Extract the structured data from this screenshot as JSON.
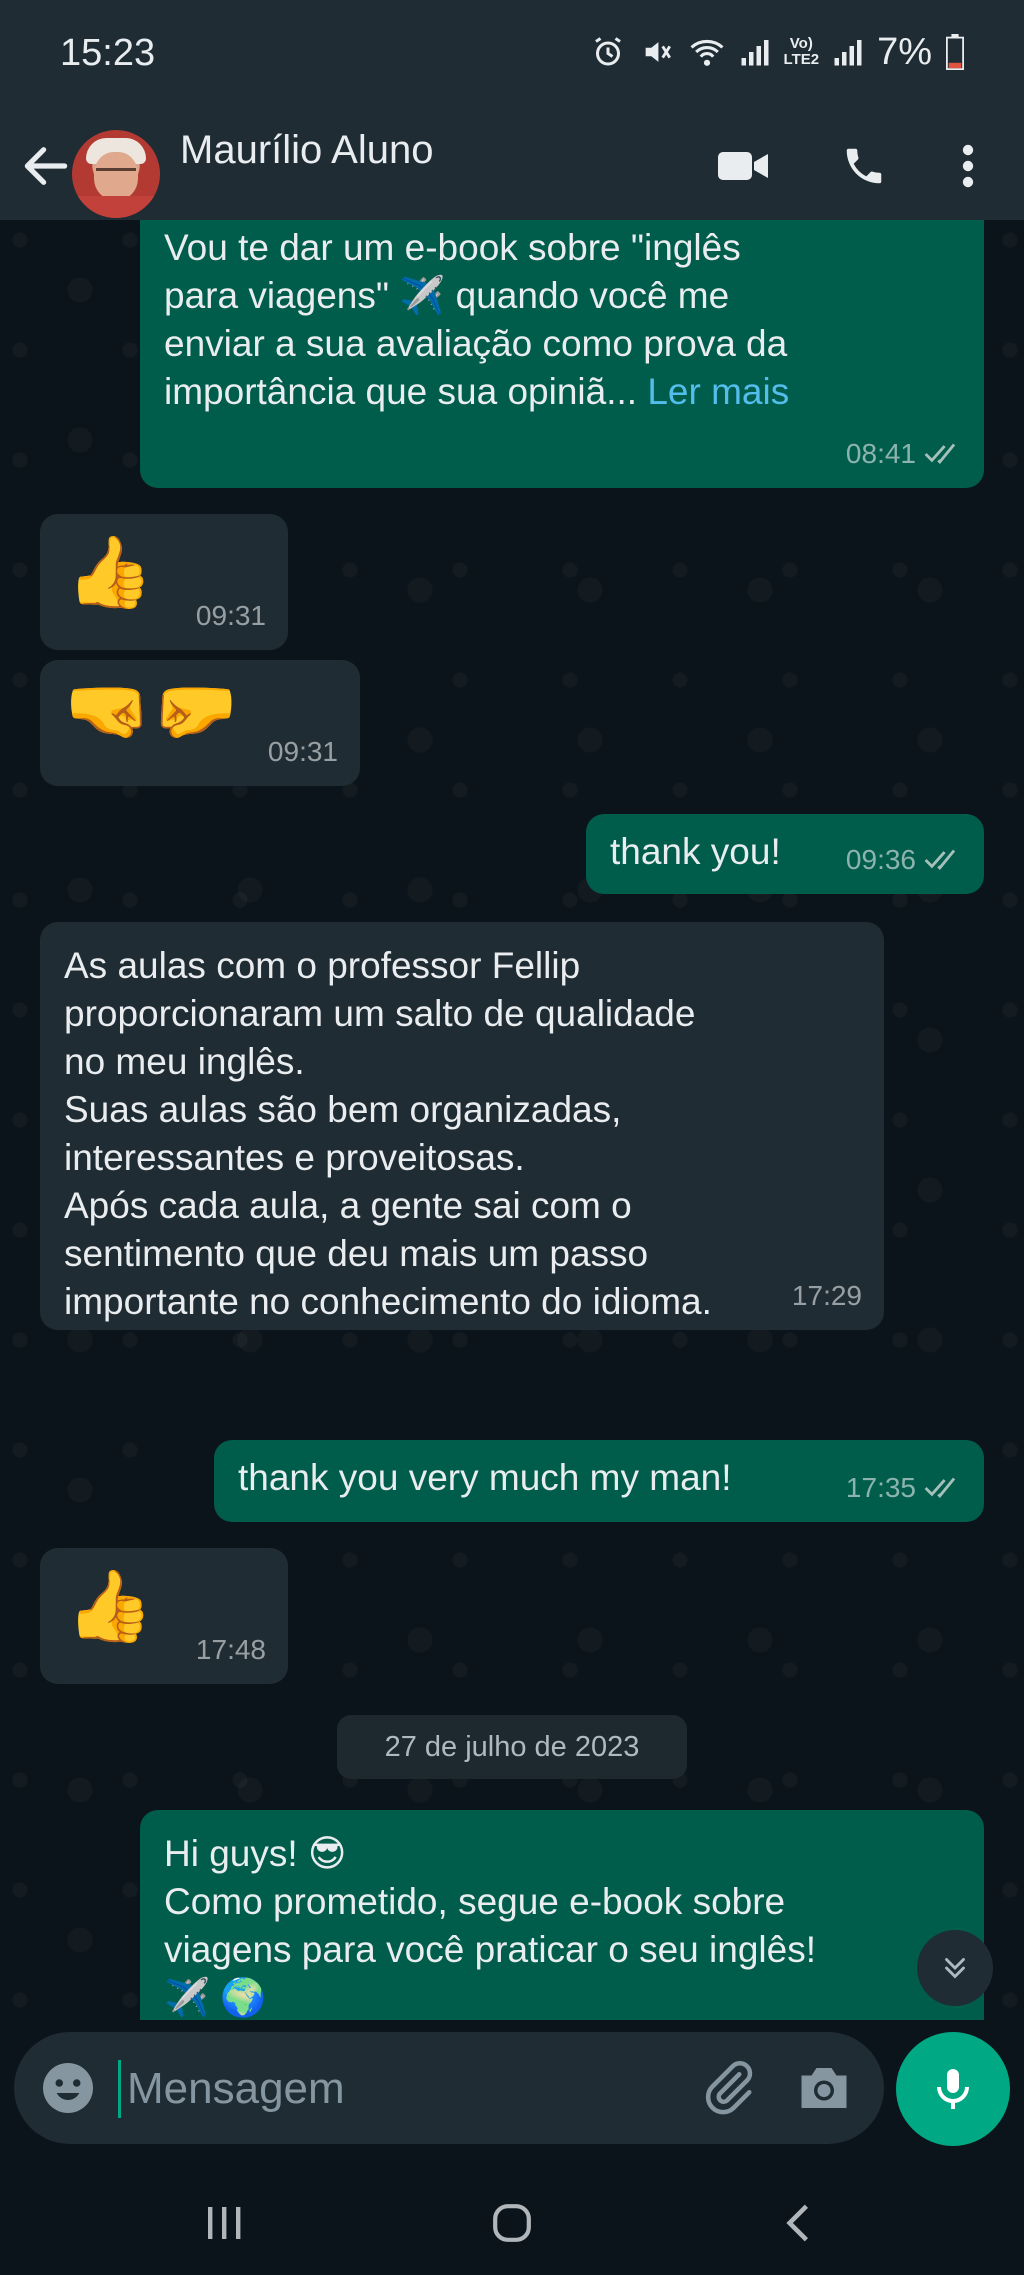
{
  "status_bar": {
    "time": "15:23",
    "lte_label_top": "Vo)",
    "lte_label_bottom": "LTE2",
    "battery": "7%"
  },
  "header": {
    "contact_name": "Maurílio Aluno",
    "icons": [
      "back-arrow-icon",
      "video-call-icon",
      "phone-icon",
      "more-vert-icon"
    ]
  },
  "messages": [
    {
      "direction": "out",
      "text": "Vou te dar um e-book sobre \"inglês\npara viagens\" ✈️ quando você me\nenviar a sua avaliação como prova da\nimportância que sua opiniã...",
      "read_more": "Ler mais",
      "time": "08:41",
      "status": "read"
    },
    {
      "direction": "in",
      "emoji": "👍",
      "time": "09:31"
    },
    {
      "direction": "in",
      "emoji": "🤜🤛",
      "time": "09:31"
    },
    {
      "direction": "out",
      "text": "thank you!",
      "time": "09:36",
      "status": "read"
    },
    {
      "direction": "in",
      "text": "As aulas com o professor Fellip\nproporcionaram um salto de qualidade\nno meu inglês.\nSuas aulas são bem organizadas,\ninteressantes e proveitosas.\nApós cada aula, a gente sai com o\nsentimento que deu mais um passo\nimportante no conhecimento do idioma.",
      "time": "17:29"
    },
    {
      "direction": "out",
      "text": "thank you very much my man!",
      "time": "17:35",
      "status": "read"
    },
    {
      "direction": "in",
      "emoji": "👍",
      "time": "17:48"
    },
    {
      "direction": "out",
      "text": "Hi guys! 😎\nComo prometido, segue e-book sobre\nviagens para você praticar o seu inglês!\n✈️ 🌍"
    }
  ],
  "date_divider": "27 de julho de 2023",
  "input": {
    "placeholder": "Mensagem"
  },
  "colors": {
    "outgoing_bubble": "#005c4b",
    "incoming_bubble": "#202c33",
    "chat_background": "#0b141a",
    "header": "#1f2c34",
    "accent": "#00a884",
    "link": "#53bdeb"
  }
}
